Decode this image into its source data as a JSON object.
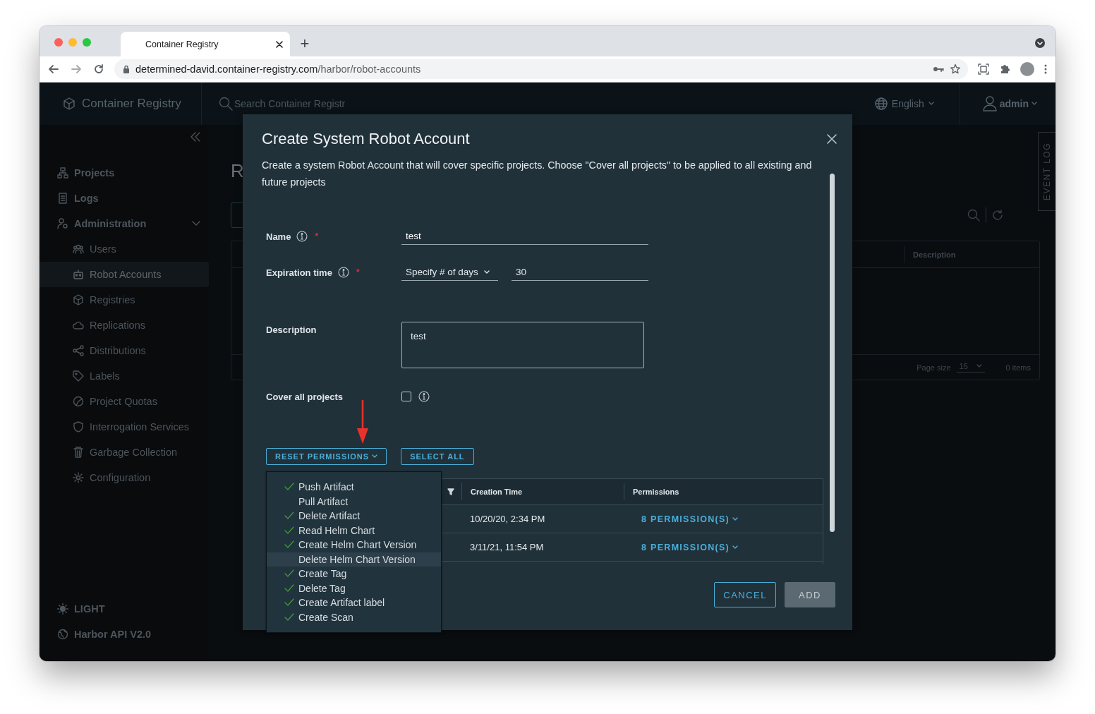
{
  "browser": {
    "tab_title": "Container Registry",
    "new_tab": "+",
    "url_host": "determined-david.container-registry.com",
    "url_path": "/harbor/robot-accounts"
  },
  "header": {
    "product": "Container Registry",
    "search_placeholder": "Search Container Registr",
    "language": "English",
    "user": "admin"
  },
  "sidebar": {
    "items": [
      {
        "label": "Projects",
        "selected": false
      },
      {
        "label": "Logs",
        "selected": false
      },
      {
        "label": "Administration",
        "selected": false,
        "expanded": true,
        "children": [
          {
            "label": "Users",
            "selected": false
          },
          {
            "label": "Robot Accounts",
            "selected": true
          },
          {
            "label": "Registries",
            "selected": false
          },
          {
            "label": "Replications",
            "selected": false
          },
          {
            "label": "Distributions",
            "selected": false
          },
          {
            "label": "Labels",
            "selected": false
          },
          {
            "label": "Project Quotas",
            "selected": false
          },
          {
            "label": "Interrogation Services",
            "selected": false
          },
          {
            "label": "Garbage Collection",
            "selected": false
          },
          {
            "label": "Configuration",
            "selected": false
          }
        ]
      }
    ],
    "footer": [
      "LIGHT",
      "Harbor API V2.0"
    ]
  },
  "page": {
    "title": "R",
    "columns": [
      "Description"
    ],
    "page_size_label": "Page size",
    "page_size": "15",
    "item_count": "0 items",
    "event_log": "EVENT LOG"
  },
  "modal": {
    "title": "Create System Robot Account",
    "intro": "Create a system Robot Account that will cover specific projects. Choose \"Cover all projects\" to be applied to all existing and future projects",
    "fields": [
      {
        "kind": "text",
        "label": "Name",
        "info": true,
        "required_mark": "*",
        "value": "test"
      },
      {
        "kind": "select_text",
        "label": "Expiration time",
        "info": true,
        "required_mark": "*",
        "select": "Specify # of days",
        "value": "30"
      },
      {
        "kind": "textarea",
        "label": "Description",
        "info": false,
        "value": "test"
      },
      {
        "kind": "checkbox",
        "label": "Cover all projects",
        "info": true,
        "checked": false
      }
    ],
    "actions": [
      "RESET PERMISSIONS",
      "SELECT ALL"
    ],
    "permission_menu": [
      {
        "label": "Push Artifact",
        "checked": true,
        "selected": false
      },
      {
        "label": "Pull Artifact",
        "checked": false,
        "selected": false
      },
      {
        "label": "Delete Artifact",
        "checked": true,
        "selected": false
      },
      {
        "label": "Read Helm Chart",
        "checked": true,
        "selected": false
      },
      {
        "label": "Create Helm Chart Version",
        "checked": true,
        "selected": false
      },
      {
        "label": "Delete Helm Chart Version",
        "checked": false,
        "selected": true
      },
      {
        "label": "Create Tag",
        "checked": true,
        "selected": false
      },
      {
        "label": "Delete Tag",
        "checked": true,
        "selected": false
      },
      {
        "label": "Create Artifact label",
        "checked": true,
        "selected": false
      },
      {
        "label": "Create Scan",
        "checked": true,
        "selected": false
      }
    ],
    "table": {
      "columns": [
        "Creation Time",
        "Permissions"
      ],
      "rows": [
        {
          "created": "10/20/20, 2:34 PM",
          "permissions": "8 PERMISSION(S)"
        },
        {
          "created": "3/11/21, 11:54 PM",
          "permissions": "8 PERMISSION(S)"
        }
      ]
    },
    "footer": [
      {
        "label": "CANCEL",
        "disabled": false
      },
      {
        "label": "ADD",
        "disabled": true
      }
    ]
  }
}
